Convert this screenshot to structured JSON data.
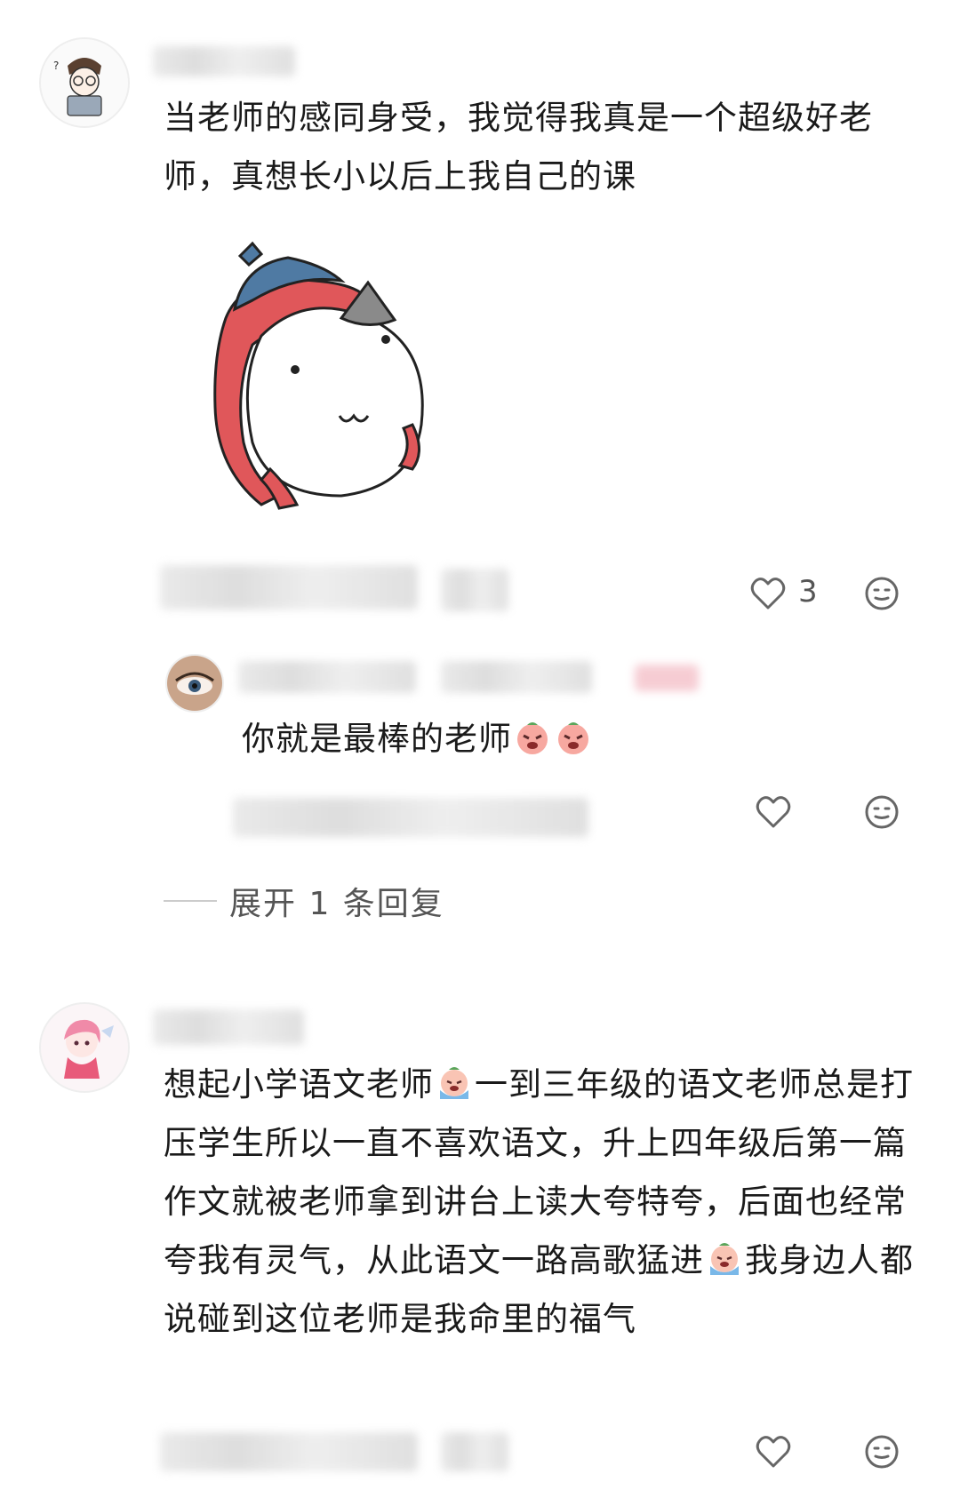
{
  "comments": [
    {
      "avatar": "avatar-drawing-glasses",
      "text": "当老师的感同身受，我觉得我真是一个超级好老师，真想长小以后上我自己的课",
      "sticker": "cat-cap-sticker",
      "likes": "3"
    },
    {
      "avatar": "avatar-anime-girl",
      "text_parts": [
        "想起小学语文老师",
        "一到三年级的语文老师总是打压学生所以一直不喜欢语文，升上四年级后第一篇作文就被老师拿到讲台上读大夸特夸，后面也经常夸我有灵气，从此语文一路高歌猛进",
        "我身边人都说碰到这位老师是我命里的福气"
      ]
    }
  ],
  "reply": {
    "avatar": "avatar-eye-closeup",
    "text": "你就是最棒的老师"
  },
  "expand_label": "展开 1 条回复",
  "colors": {
    "text": "#1a1a1a",
    "muted": "#555555",
    "icon": "#666666",
    "sticker_red": "#e0575a",
    "sticker_blue": "#4f7aa3"
  }
}
